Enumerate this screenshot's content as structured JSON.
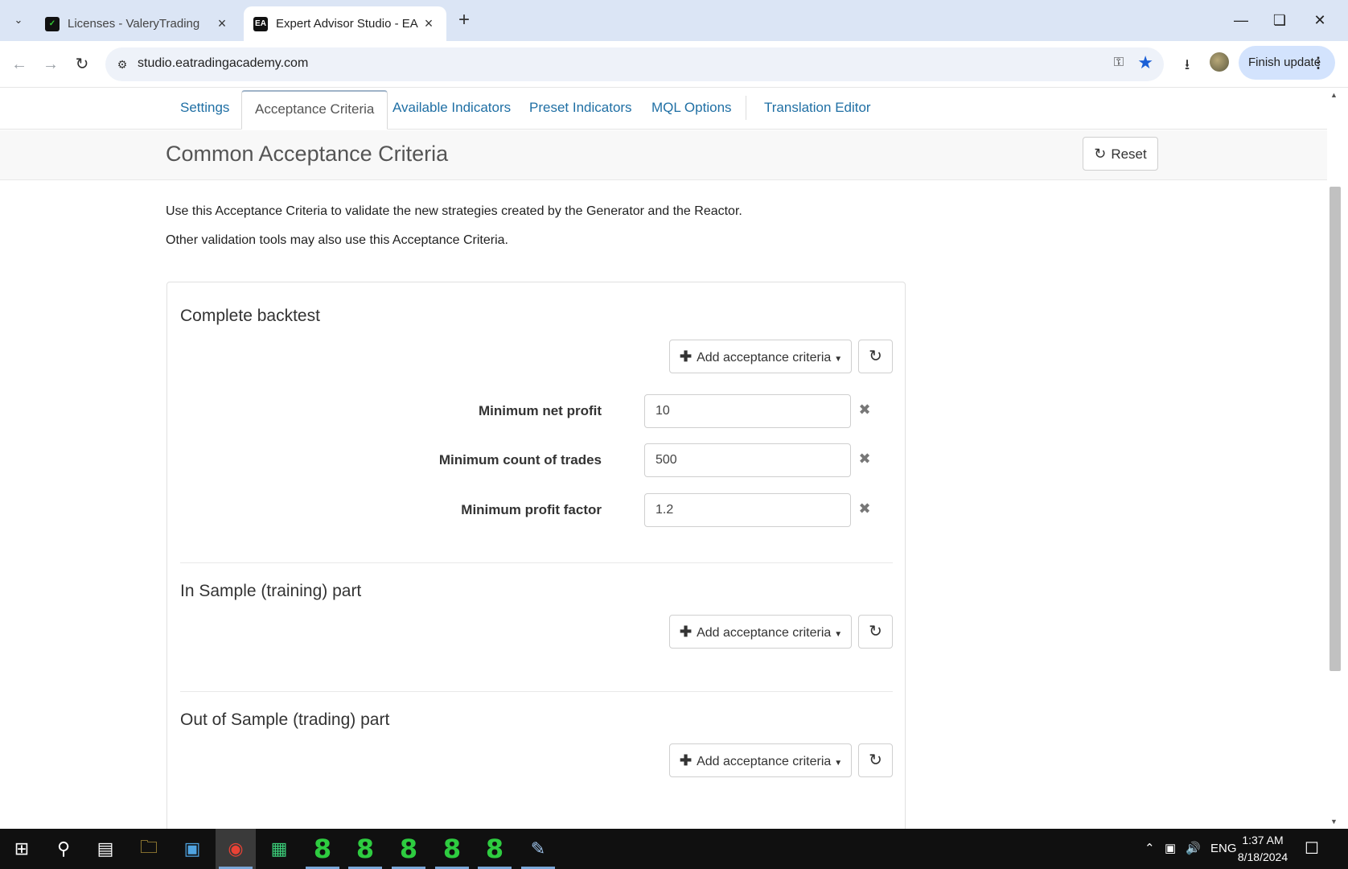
{
  "browser": {
    "tabs": [
      {
        "title": "Licenses - ValeryTrading",
        "favicon": "chart-icon"
      },
      {
        "title": "Expert Advisor Studio - EA Tradi",
        "favicon_text": "EA"
      }
    ],
    "url": "studio.eatradingacademy.com",
    "update_label": "Finish update"
  },
  "nav": {
    "tabs": [
      "Settings",
      "Acceptance Criteria",
      "Available Indicators",
      "Preset Indicators",
      "MQL Options",
      "Translation Editor"
    ],
    "active_index": 1
  },
  "header": {
    "title": "Common Acceptance Criteria",
    "reset_label": "Reset"
  },
  "description": {
    "line1": "Use this Acceptance Criteria to validate the new strategies created by the Generator and the Reactor.",
    "line2": "Other validation tools may also use this Acceptance Criteria."
  },
  "sections": [
    {
      "title": "Complete backtest",
      "add_label": "Add acceptance criteria",
      "criteria": [
        {
          "label": "Minimum net profit",
          "value": "10"
        },
        {
          "label": "Minimum count of trades",
          "value": "500"
        },
        {
          "label": "Minimum profit factor",
          "value": "1.2"
        }
      ]
    },
    {
      "title": "In Sample (training) part",
      "add_label": "Add acceptance criteria",
      "criteria": []
    },
    {
      "title": "Out of Sample (trading) part",
      "add_label": "Add acceptance criteria",
      "criteria": []
    }
  ],
  "taskbar": {
    "language": "ENG",
    "time": "1:37 AM",
    "date": "8/18/2024",
    "app_digit": "8"
  },
  "colors": {
    "link": "#1f6fa4",
    "taskbar": "#101010",
    "terminal_icon": "#2ecc40",
    "bookmark_star": "#1a5fd6"
  }
}
